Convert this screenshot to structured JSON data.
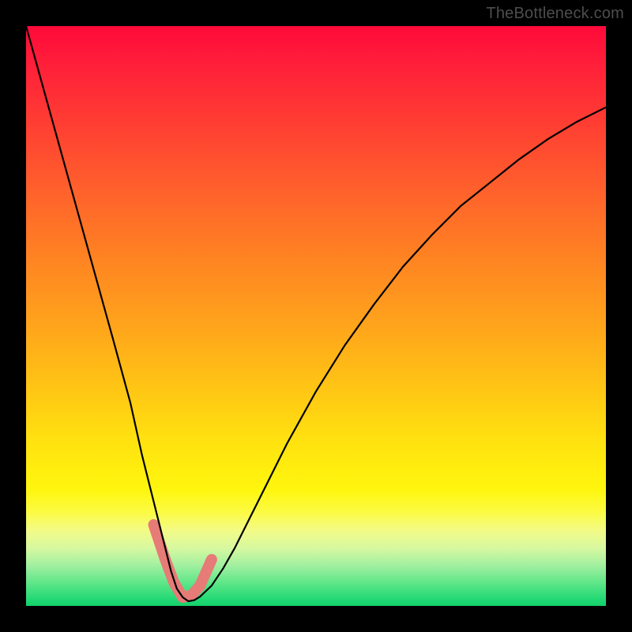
{
  "watermark": "TheBottleneck.com",
  "chart_data": {
    "type": "line",
    "title": "",
    "xlabel": "",
    "ylabel": "",
    "xlim": [
      0,
      100
    ],
    "ylim": [
      0,
      100
    ],
    "grid": false,
    "legend": false,
    "curve": {
      "x": [
        0,
        5,
        10,
        15,
        18,
        20,
        22,
        24,
        25,
        26,
        27,
        28,
        29,
        30,
        32,
        34,
        36,
        40,
        45,
        50,
        55,
        60,
        65,
        70,
        75,
        80,
        85,
        90,
        95,
        100
      ],
      "y": [
        100,
        82,
        64,
        46,
        35,
        26,
        18,
        10,
        6,
        3,
        1.5,
        0.8,
        1.0,
        1.6,
        3.5,
        6.5,
        10,
        18,
        28,
        37,
        45,
        52,
        58.5,
        64,
        69,
        73,
        77,
        80.5,
        83.5,
        86
      ]
    },
    "beads": {
      "x": [
        22.0,
        24.0,
        25.5,
        27.0,
        28.5,
        30.0,
        32.0
      ],
      "y": [
        14.0,
        8.0,
        4.0,
        1.5,
        1.8,
        3.5,
        8.0
      ]
    },
    "background_gradient_stops": [
      {
        "pos": 0.0,
        "color": "#ff0a3a"
      },
      {
        "pos": 0.3,
        "color": "#ff602c"
      },
      {
        "pos": 0.6,
        "color": "#ffc714"
      },
      {
        "pos": 0.8,
        "color": "#fff60e"
      },
      {
        "pos": 0.93,
        "color": "#a2f0a0"
      },
      {
        "pos": 1.0,
        "color": "#14d06a"
      }
    ]
  }
}
